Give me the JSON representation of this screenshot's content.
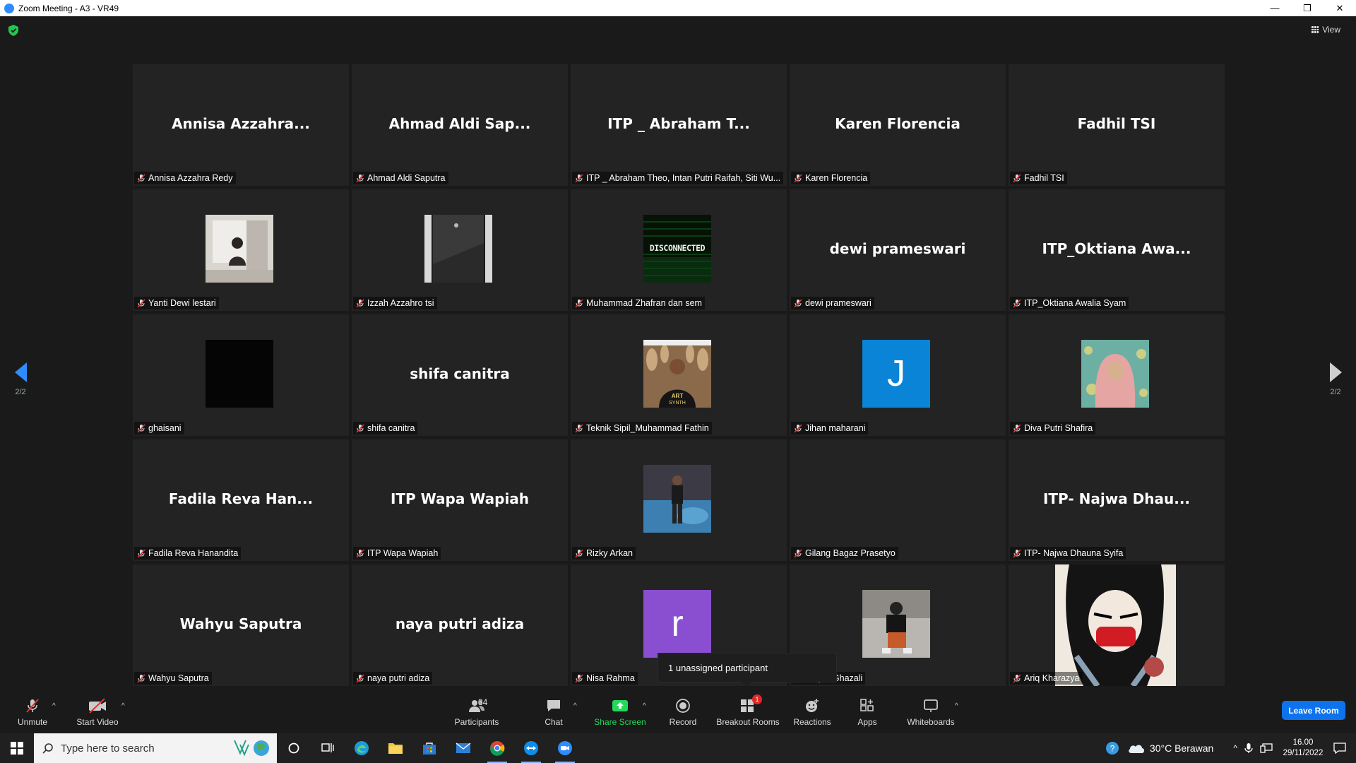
{
  "window": {
    "title": "Zoom Meeting - A3 - VR49",
    "minimize": "—",
    "restore": "❐",
    "close": "✕"
  },
  "header": {
    "view_label": "View"
  },
  "pagination": {
    "left": "2/2",
    "right": "2/2"
  },
  "tiles": [
    {
      "big": "Annisa Azzahra...",
      "label": "Annisa Azzahra Redy"
    },
    {
      "big": "Ahmad Aldi Sap...",
      "label": "Ahmad Aldi Saputra"
    },
    {
      "big": "ITP _ Abraham T...",
      "label": "ITP _ Abraham Theo, Intan Putri Raifah, Siti Wu..."
    },
    {
      "big": "Karen Florencia",
      "label": "Karen Florencia"
    },
    {
      "big": "Fadhil TSI",
      "label": "Fadhil TSI"
    },
    {
      "big": "",
      "label": "Yanti Dewi lestari",
      "pic": "photo-room"
    },
    {
      "big": "",
      "label": "Izzah Azzahro tsi",
      "pic": "photo-dark"
    },
    {
      "big": "",
      "label": "Muhammad Zhafran dan sem",
      "pic": "disconnected",
      "pic_text": "DISCONNECTED"
    },
    {
      "big": "dewi prameswari",
      "label": "dewi prameswari"
    },
    {
      "big": "ITP_Oktiana Awa...",
      "label": "ITP_Oktiana Awalia Syam"
    },
    {
      "big": "",
      "label": "ghaisani",
      "pic": "black"
    },
    {
      "big": "shifa canitra",
      "label": "shifa canitra"
    },
    {
      "big": "",
      "label": "Teknik Sipil_Muhammad Fathin",
      "pic": "photo-person"
    },
    {
      "big": "",
      "label": "Jihan maharani",
      "avatar": "J",
      "avatar_color": "#0a84d6"
    },
    {
      "big": "",
      "label": "Diva Putri Shafira",
      "pic": "photo-hijab"
    },
    {
      "big": "Fadila Reva Han...",
      "label": "Fadila Reva Hanandita"
    },
    {
      "big": "ITP Wapa Wapiah",
      "label": "ITP Wapa Wapiah"
    },
    {
      "big": "",
      "label": "Rizky Arkan",
      "pic": "photo-pool"
    },
    {
      "big": "",
      "label": "Gilang Bagaz Prasetyo"
    },
    {
      "big": "ITP- Najwa Dhau...",
      "label": "ITP- Najwa Dhauna Syifa"
    },
    {
      "big": "Wahyu Saputra",
      "label": "Wahyu Saputra"
    },
    {
      "big": "naya putri adiza",
      "label": "naya putri adiza"
    },
    {
      "big": "",
      "label": "Nisa Rahma",
      "avatar": "r",
      "avatar_color": "#8a4fd1"
    },
    {
      "big": "",
      "label": "Afiq Al Ghazali",
      "pic": "photo-sitting"
    },
    {
      "big": "",
      "label": "Ariq Kharazya",
      "pic": "anime"
    }
  ],
  "tooltip": {
    "text": "1 unassigned participant"
  },
  "toolbar": {
    "unmute": "Unmute",
    "start_video": "Start Video",
    "participants": "Participants",
    "participants_count": "34",
    "chat": "Chat",
    "share_screen": "Share Screen",
    "record": "Record",
    "breakout_rooms": "Breakout Rooms",
    "breakout_badge": "1",
    "reactions": "Reactions",
    "apps": "Apps",
    "whiteboards": "Whiteboards",
    "leave": "Leave Room",
    "share_color": "#23d959",
    "leave_color": "#0e72ed"
  },
  "taskbar": {
    "search_placeholder": "Type here to search",
    "weather": "30°C  Berawan",
    "time": "16.00",
    "date": "29/11/2022"
  }
}
